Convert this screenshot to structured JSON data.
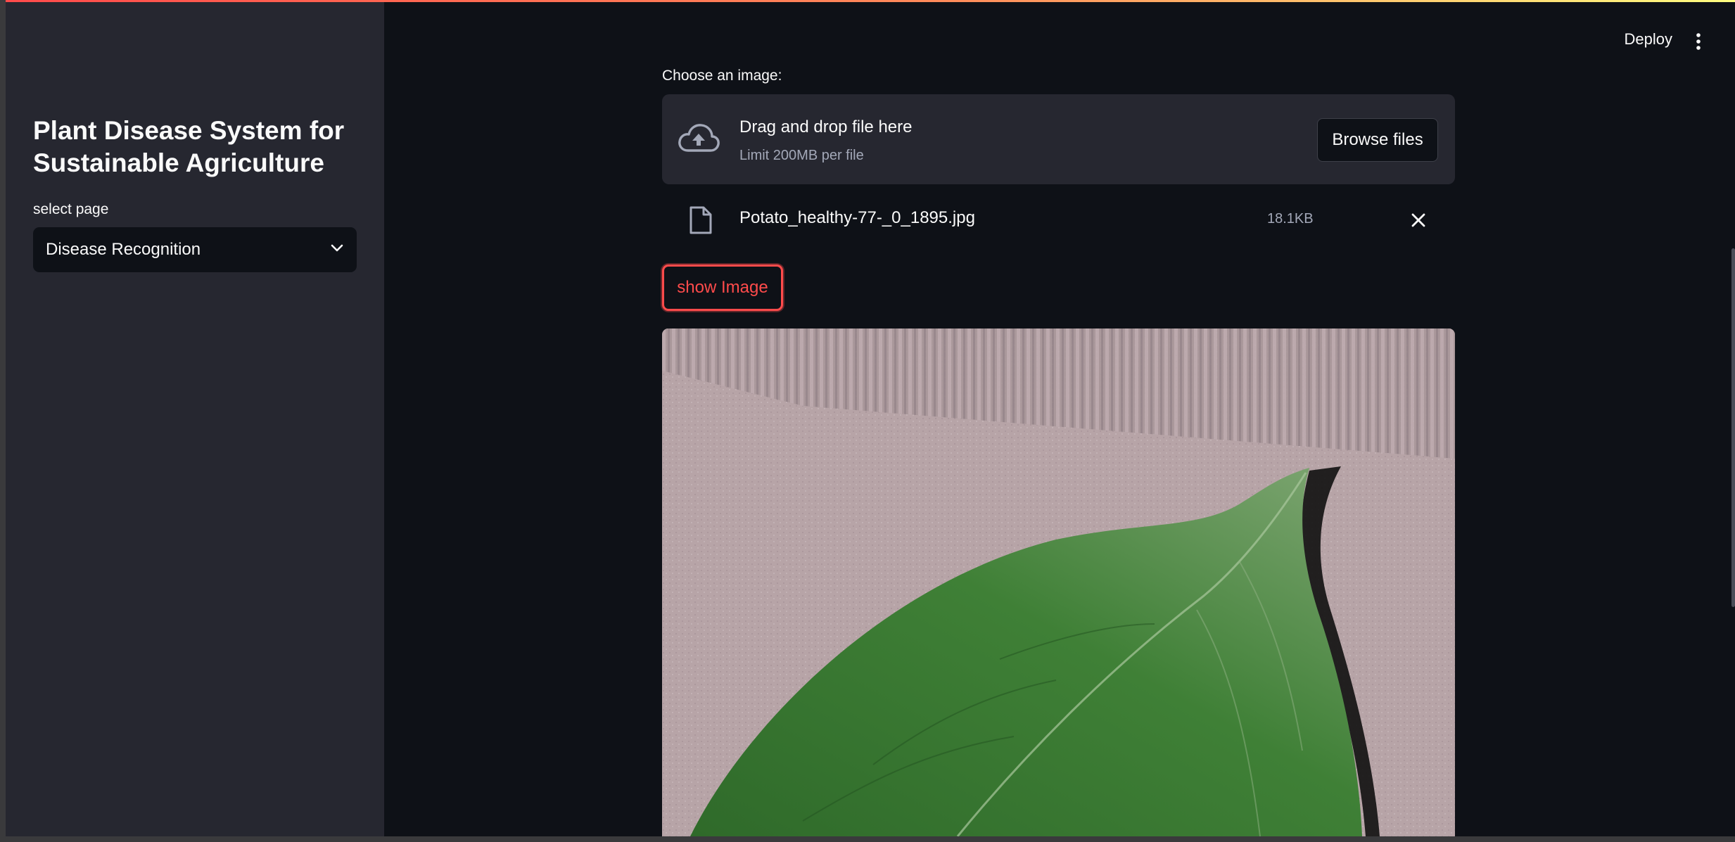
{
  "sidebar": {
    "title": "Plant Disease System for Sustainable Agriculture",
    "select_label": "select page",
    "select_value": "Disease Recognition"
  },
  "header": {
    "deploy_label": "Deploy",
    "menu_icon": "vertical-ellipsis-icon"
  },
  "uploader": {
    "label": "Choose an image:",
    "drop_title": "Drag and drop file here",
    "drop_limit": "Limit 200MB per file",
    "browse_label": "Browse files",
    "icon": "cloud-upload-icon"
  },
  "uploaded_file": {
    "name": "Potato_healthy-77-_0_1895.jpg",
    "size": "18.1KB",
    "icon": "file-icon",
    "remove_icon": "close-icon"
  },
  "show_button": {
    "label": "show Image"
  },
  "colors": {
    "background": "#0e1117",
    "sidebar": "#262730",
    "accent": "#ff4b4b",
    "text": "#fafafa",
    "muted_text": "#a3a8b8"
  }
}
